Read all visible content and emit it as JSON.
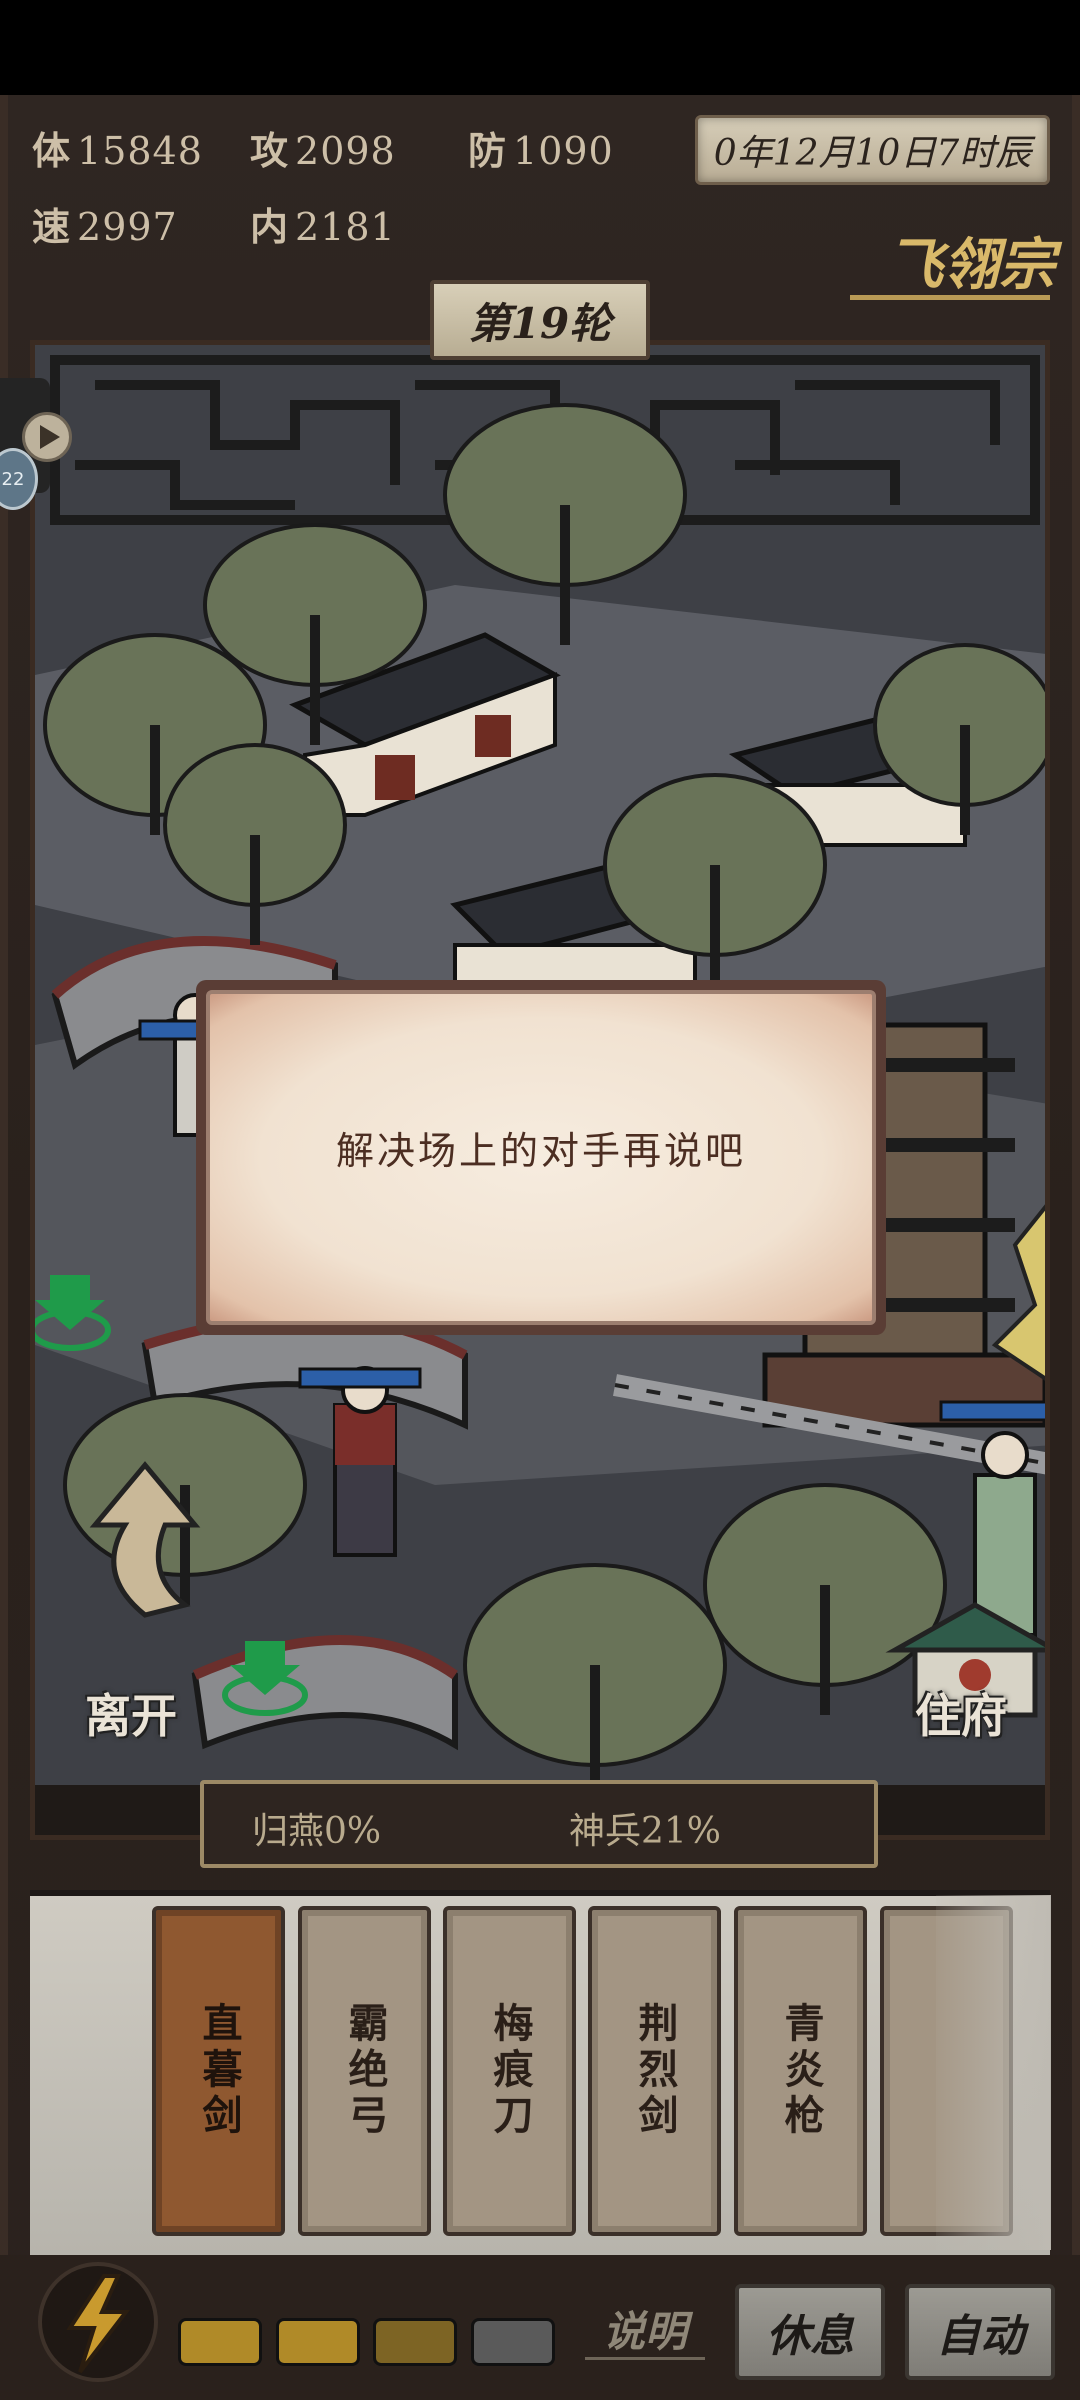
{
  "stats": [
    {
      "key": "体",
      "value": "15848"
    },
    {
      "key": "攻",
      "value": "2098"
    },
    {
      "key": "防",
      "value": "1090"
    },
    {
      "key": "速",
      "value": "2997"
    },
    {
      "key": "内",
      "value": "2181"
    }
  ],
  "game_time": "0年12月10日7时辰",
  "sect_name": "飞翎宗",
  "round_label": "第19轮",
  "side_badge": "22",
  "dialog_message": "解决场上的对手再说吧",
  "map": {
    "leave_label": "离开",
    "residence_label": "住府"
  },
  "progress": {
    "guiyan": "归燕0%",
    "shenbing": "神兵21%"
  },
  "skills": [
    {
      "name": "直暮剑",
      "active": true
    },
    {
      "name": "霸绝弓",
      "active": false
    },
    {
      "name": "梅痕刀",
      "active": false
    },
    {
      "name": "荆烈剑",
      "active": false
    },
    {
      "name": "青炎枪",
      "active": false
    }
  ],
  "energy_slots": [
    {
      "color": "#b08a28"
    },
    {
      "color": "#b08a28"
    },
    {
      "color": "#7d6424"
    },
    {
      "color": "#5a5a5a"
    }
  ],
  "buttons": {
    "help": "说明",
    "rest": "休息",
    "auto": "自动"
  },
  "colors": {
    "accent_gold": "#d9b96a",
    "active_skill": "#8f5830",
    "hp_bar_blue": "#2c5fa8",
    "marker_green": "#1f9b4a"
  }
}
